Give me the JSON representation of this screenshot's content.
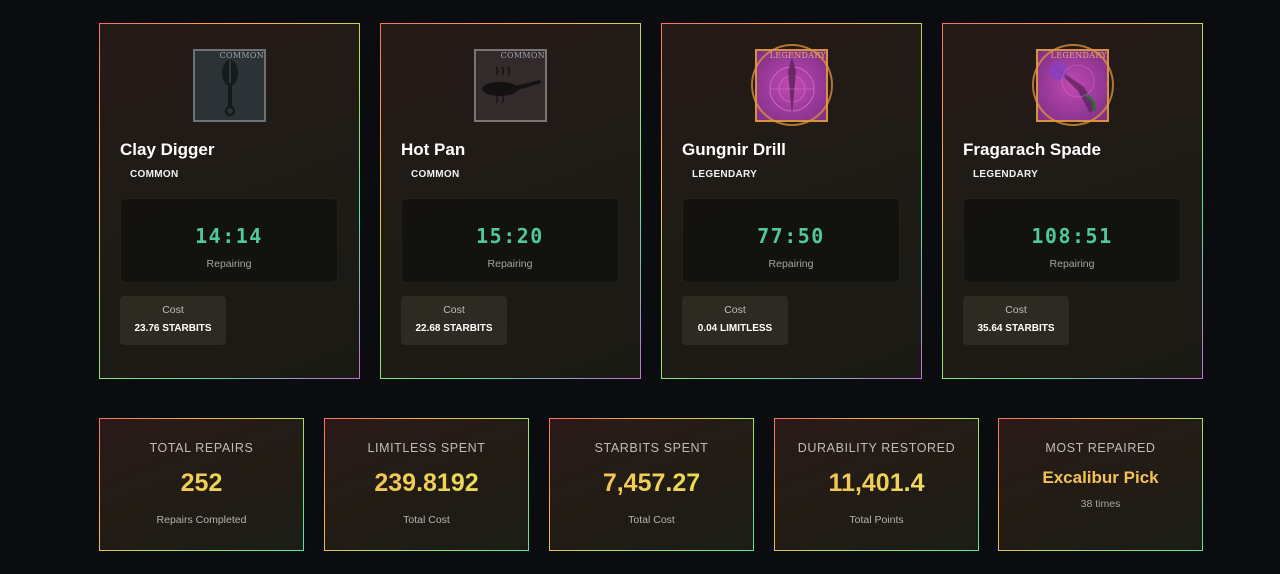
{
  "repairs": [
    {
      "name": "Clay Digger",
      "rarity": "COMMON",
      "image_tag": "COMMON",
      "icon": "shovel-icon",
      "timer": "14:14",
      "status": "Repairing",
      "cost_label": "Cost",
      "cost_value": "23.76 STARBITS"
    },
    {
      "name": "Hot Pan",
      "rarity": "COMMON",
      "image_tag": "COMMON",
      "icon": "frying-pan-icon",
      "timer": "15:20",
      "status": "Repairing",
      "cost_label": "Cost",
      "cost_value": "22.68 STARBITS"
    },
    {
      "name": "Gungnir Drill",
      "rarity": "LEGENDARY",
      "image_tag": "LEGENDARY",
      "icon": "drill-icon",
      "timer": "77:50",
      "status": "Repairing",
      "cost_label": "Cost",
      "cost_value": "0.04 LIMITLESS"
    },
    {
      "name": "Fragarach Spade",
      "rarity": "LEGENDARY",
      "image_tag": "LEGENDARY",
      "icon": "spade-icon",
      "timer": "108:51",
      "status": "Repairing",
      "cost_label": "Cost",
      "cost_value": "35.64 STARBITS"
    }
  ],
  "stats": {
    "total_repairs": {
      "label": "TOTAL REPAIRS",
      "value": "252",
      "sub": "Repairs Completed"
    },
    "limitless_spent": {
      "label": "LIMITLESS SPENT",
      "value": "239.8192",
      "sub": "Total Cost"
    },
    "starbits_spent": {
      "label": "STARBITS SPENT",
      "value": "7,457.27",
      "sub": "Total Cost"
    },
    "durability_restored": {
      "label": "DURABILITY RESTORED",
      "value": "11,401.4",
      "sub": "Total Points"
    },
    "most_repaired": {
      "label": "MOST REPAIRED",
      "name": "Excalibur Pick",
      "times": "38 times"
    }
  },
  "colors": {
    "background": "#0b0c10",
    "timer": "#4fc99a",
    "stat_value": "#f2d45a",
    "legendary_frame": "#d6923c"
  }
}
